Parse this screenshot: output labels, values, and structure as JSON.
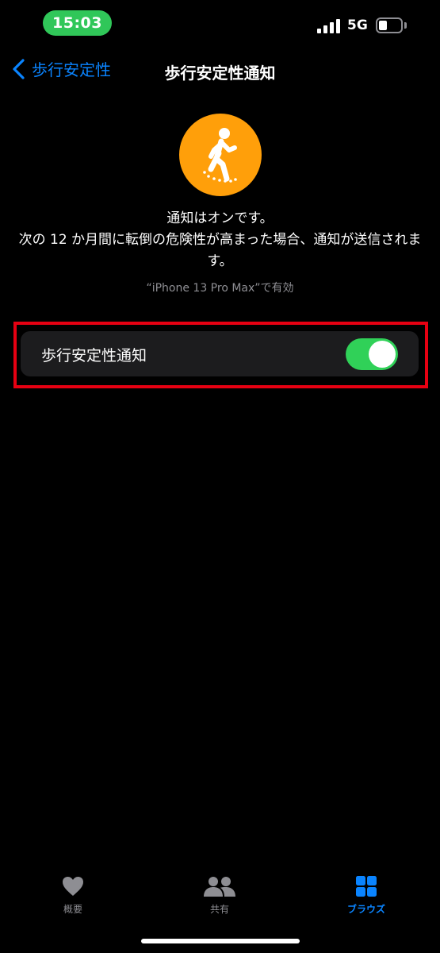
{
  "status_bar": {
    "time": "15:03",
    "network": "5G",
    "battery_level": 0.4,
    "colors": {
      "time_pill": "#30c759"
    }
  },
  "nav": {
    "back_label": "歩行安定性",
    "title": "歩行安定性通知",
    "back_icon": "chevron-left-icon"
  },
  "hero": {
    "icon": "walking-person-icon",
    "icon_bg": "#ff9f0a",
    "line1": "通知はオンです。",
    "line2": "次の 12 か月間に転倒の危険性が高まった場合、通知が送信されます。",
    "device_note": "“iPhone 13 Pro Max”で有効"
  },
  "setting": {
    "label": "歩行安定性通知",
    "enabled": true,
    "switch_color": "#30d158",
    "highlight_color": "#e60012"
  },
  "tabs": [
    {
      "label": "概要",
      "icon": "heart-icon",
      "active": false
    },
    {
      "label": "共有",
      "icon": "people-icon",
      "active": false
    },
    {
      "label": "ブラウズ",
      "icon": "grid-icon",
      "active": true
    }
  ],
  "colors": {
    "accent": "#0a84ff",
    "inactive": "#8e8e93"
  }
}
